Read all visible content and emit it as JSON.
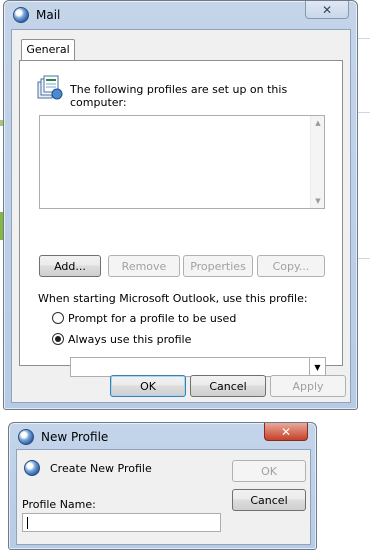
{
  "mail_dialog": {
    "title": "Mail",
    "close_glyph": "✕",
    "tab_label": "General",
    "profiles_label": "The following profiles are set up on this computer:",
    "profiles_list": [],
    "buttons": {
      "add": "Add...",
      "remove": "Remove",
      "properties": "Properties",
      "copy": "Copy..."
    },
    "startup_label": "When starting Microsoft Outlook, use this profile:",
    "radio_prompt": "Prompt for a profile to be used",
    "radio_always": "Always use this profile",
    "selected_radio": "always",
    "profile_combo_value": "",
    "footer": {
      "ok": "OK",
      "cancel": "Cancel",
      "apply": "Apply"
    }
  },
  "new_profile_dialog": {
    "title": "New Profile",
    "close_glyph": "✕",
    "heading": "Create New Profile",
    "ok": "OK",
    "cancel": "Cancel",
    "name_label": "Profile Name:",
    "name_value": ""
  },
  "icons": {
    "app": "mail-globe-icon",
    "profiles": "profiles-cards-icon",
    "scroll_up": "scroll-up-arrow-icon",
    "scroll_down": "scroll-down-arrow-icon",
    "combo": "chevron-down-icon",
    "close": "close-icon"
  },
  "colors": {
    "title_bar": "#c4d5ea",
    "client": "#f0f0f0",
    "close_active": "#c6412a",
    "default_button_border": "#3c7fb1"
  }
}
